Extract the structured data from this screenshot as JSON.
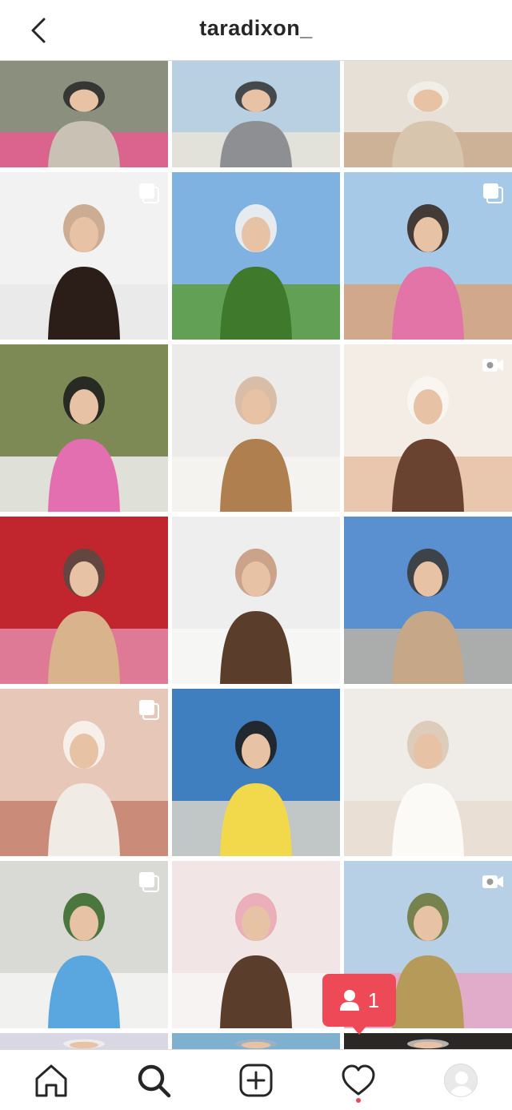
{
  "header": {
    "username": "taradixon_",
    "back_icon": "chevron-left-icon"
  },
  "grid": {
    "tiles": [
      {
        "name": "photo-family-walk",
        "badge": null,
        "colors": [
          "#8a8f7e",
          "#c9c2b4",
          "#e75d8f",
          "#2c2c2c"
        ]
      },
      {
        "name": "photo-family-bridge",
        "badge": null,
        "colors": [
          "#b9d0e3",
          "#8d8f92",
          "#e9e4d8",
          "#3a3a3a"
        ]
      },
      {
        "name": "photo-girls-dresses",
        "badge": null,
        "colors": [
          "#e7e0d6",
          "#d7c5ad",
          "#c9a98c",
          "#f2efe9"
        ]
      },
      {
        "name": "photo-two-girls-studio",
        "badge": "carousel-icon",
        "colors": [
          "#f2f2f2",
          "#2b1d17",
          "#e9e9e9",
          "#c8a58a"
        ]
      },
      {
        "name": "photo-woman-vineyard",
        "badge": null,
        "colors": [
          "#7fb2e0",
          "#3f7a2c",
          "#5d9c3c",
          "#f1f1f1"
        ]
      },
      {
        "name": "photo-women-selfie-sunglasses",
        "badge": "carousel-icon",
        "colors": [
          "#a7c9e8",
          "#e274a8",
          "#d9a27c",
          "#3a2a22"
        ]
      },
      {
        "name": "photo-three-women",
        "badge": null,
        "colors": [
          "#7d8a55",
          "#e46fb0",
          "#f0f0f0",
          "#1f1f1f"
        ]
      },
      {
        "name": "photo-girl-portrait",
        "badge": null,
        "colors": [
          "#ecebe9",
          "#b07f4f",
          "#f6f4f1",
          "#d7b9a0"
        ]
      },
      {
        "name": "photo-girl-closeup",
        "badge": "reel-icon",
        "colors": [
          "#f4ede5",
          "#6a4330",
          "#e6bfa4",
          "#f9f6f2"
        ]
      },
      {
        "name": "photo-women-restaurant",
        "badge": null,
        "colors": [
          "#c1262e",
          "#d9b38c",
          "#e48aa8",
          "#5a4a44"
        ]
      },
      {
        "name": "photo-woman-coffee",
        "badge": null,
        "colors": [
          "#eeeeee",
          "#5b3d2c",
          "#f7f7f5",
          "#c59a7e"
        ]
      },
      {
        "name": "photo-family-beach",
        "badge": null,
        "colors": [
          "#5a8fd0",
          "#c6a889",
          "#b9b3a5",
          "#3b3b3b"
        ]
      },
      {
        "name": "photo-massage-spa",
        "badge": "carousel-icon",
        "colors": [
          "#e7c7b7",
          "#f1ebe6",
          "#c4806f",
          "#f7f3ef"
        ]
      },
      {
        "name": "photo-boy-basketball",
        "badge": null,
        "colors": [
          "#3f7fc0",
          "#f2d84b",
          "#d8d2c8",
          "#1f1f1f"
        ]
      },
      {
        "name": "photo-orchid-vase",
        "badge": null,
        "colors": [
          "#efece7",
          "#fbfaf7",
          "#e7ddd1",
          "#d9c9b4"
        ]
      },
      {
        "name": "photo-family-house",
        "badge": "carousel-icon",
        "colors": [
          "#d9d9d6",
          "#5aa6de",
          "#f5f5f5",
          "#3b6b2f"
        ]
      },
      {
        "name": "photo-woman-laptop",
        "badge": null,
        "colors": [
          "#f1e5e6",
          "#5b3d2c",
          "#f8f6f4",
          "#e9a9b4"
        ]
      },
      {
        "name": "photo-girl-field",
        "badge": "reel-icon",
        "colors": [
          "#b8d0e6",
          "#b59a5a",
          "#e8a5c4",
          "#6f7a3d"
        ]
      },
      {
        "name": "photo-row7-left",
        "badge": null,
        "colors": [
          "#d9d7e3",
          "#e6e0dc",
          "#cfc8c3",
          "#eeeeee"
        ]
      },
      {
        "name": "photo-row7-middle",
        "badge": null,
        "colors": [
          "#7fb0cf",
          "#c4c0bc",
          "#e9e7e5",
          "#9fb3c2"
        ]
      },
      {
        "name": "photo-row7-right",
        "badge": null,
        "colors": [
          "#2b2725",
          "#e1dcd8",
          "#4d4440",
          "#c7c1bc"
        ]
      }
    ]
  },
  "notification": {
    "icon": "user-follow-icon",
    "count": "1",
    "color": "#ed4956"
  },
  "bottom_nav": {
    "items": [
      {
        "name": "home",
        "icon": "home-icon"
      },
      {
        "name": "search",
        "icon": "search-icon"
      },
      {
        "name": "new-post",
        "icon": "plus-square-icon"
      },
      {
        "name": "activity",
        "icon": "heart-icon"
      },
      {
        "name": "profile",
        "icon": "avatar-icon"
      }
    ]
  },
  "colors": {
    "accent": "#ed4956",
    "text": "#262626",
    "border": "#dbdbdb"
  }
}
